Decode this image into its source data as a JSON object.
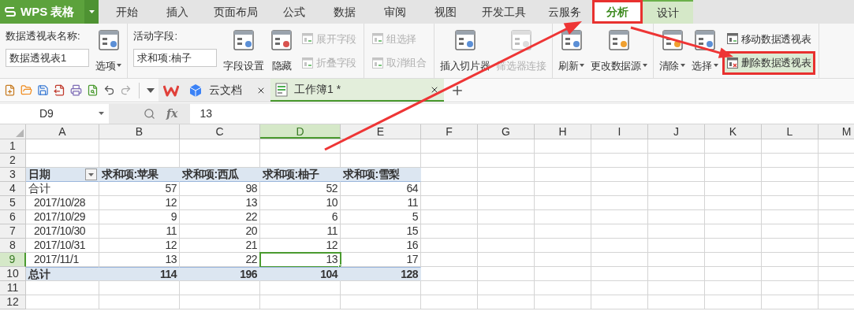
{
  "app": {
    "logo": "WPS 表格"
  },
  "menu_tabs": [
    {
      "label": "开始",
      "selected": false,
      "contextual": false,
      "highlighted": false
    },
    {
      "label": "插入",
      "selected": false,
      "contextual": false,
      "highlighted": false
    },
    {
      "label": "页面布局",
      "selected": false,
      "contextual": false,
      "highlighted": false
    },
    {
      "label": "公式",
      "selected": false,
      "contextual": false,
      "highlighted": false
    },
    {
      "label": "数据",
      "selected": false,
      "contextual": false,
      "highlighted": false
    },
    {
      "label": "审阅",
      "selected": false,
      "contextual": false,
      "highlighted": false
    },
    {
      "label": "视图",
      "selected": false,
      "contextual": false,
      "highlighted": false
    },
    {
      "label": "开发工具",
      "selected": false,
      "contextual": false,
      "highlighted": false
    },
    {
      "label": "云服务",
      "selected": false,
      "contextual": false,
      "highlighted": false
    },
    {
      "label": "分析",
      "selected": true,
      "contextual": true,
      "highlighted": true
    },
    {
      "label": "设计",
      "selected": false,
      "contextual": true,
      "highlighted": false
    }
  ],
  "ribbon": {
    "groups": [
      {
        "items": [
          {
            "kind": "field",
            "label": "数据透视表名称:",
            "value": "数据透视表1"
          },
          {
            "kind": "big",
            "label": "选项",
            "dropdown": true,
            "disabled": false
          }
        ]
      },
      {
        "items": [
          {
            "kind": "field",
            "label": "活动字段:",
            "value": "求和项:柚子"
          },
          {
            "kind": "big",
            "label": "字段设置",
            "dropdown": false,
            "disabled": false
          },
          {
            "kind": "big",
            "label": "隐藏",
            "dropdown": false,
            "disabled": false
          },
          {
            "kind": "small",
            "label": "展开字段",
            "disabled": true,
            "highlighted": false
          },
          {
            "kind": "small",
            "label": "折叠字段",
            "disabled": true,
            "highlighted": false
          }
        ]
      },
      {
        "items": [
          {
            "kind": "small",
            "label": "组选择",
            "disabled": true,
            "highlighted": false
          },
          {
            "kind": "small",
            "label": "取消组合",
            "disabled": true,
            "highlighted": false
          }
        ]
      },
      {
        "items": [
          {
            "kind": "big",
            "label": "插入切片器",
            "dropdown": false,
            "disabled": false
          },
          {
            "kind": "big",
            "label": "筛选器连接",
            "dropdown": false,
            "disabled": true
          }
        ]
      },
      {
        "items": [
          {
            "kind": "big",
            "label": "刷新",
            "dropdown": true,
            "disabled": false
          },
          {
            "kind": "big",
            "label": "更改数据源",
            "dropdown": true,
            "disabled": false
          }
        ]
      },
      {
        "items": [
          {
            "kind": "big",
            "label": "清除",
            "dropdown": true,
            "disabled": false
          },
          {
            "kind": "big",
            "label": "选择",
            "dropdown": true,
            "disabled": false
          },
          {
            "kind": "small",
            "label": "移动数据透视表",
            "disabled": false,
            "highlighted": false
          },
          {
            "kind": "small",
            "label": "删除数据透视表",
            "disabled": false,
            "highlighted": true
          }
        ]
      }
    ]
  },
  "doc_tabs": [
    {
      "kind": "home",
      "selected": false
    },
    {
      "kind": "cloud",
      "label": "云文档",
      "selected": false
    },
    {
      "kind": "sheet",
      "label": "工作簿1 *",
      "selected": true
    }
  ],
  "formula_bar": {
    "cell": "D9",
    "fx": "fx",
    "value": "13"
  },
  "sheet": {
    "columns": [
      {
        "label": "A",
        "selected": false
      },
      {
        "label": "B",
        "selected": false
      },
      {
        "label": "C",
        "selected": false
      },
      {
        "label": "D",
        "selected": true
      },
      {
        "label": "E",
        "selected": false
      },
      {
        "label": "F",
        "selected": false
      },
      {
        "label": "G",
        "selected": false
      },
      {
        "label": "H",
        "selected": false
      },
      {
        "label": "I",
        "selected": false
      },
      {
        "label": "J",
        "selected": false
      },
      {
        "label": "K",
        "selected": false
      },
      {
        "label": "L",
        "selected": false
      },
      {
        "label": "M",
        "selected": false
      }
    ],
    "rows": [
      {
        "number": "1",
        "selected": false,
        "kind": "empty"
      },
      {
        "number": "2",
        "selected": false,
        "kind": "empty"
      },
      {
        "number": "3",
        "selected": false,
        "kind": "header",
        "filter_button": true,
        "cells": [
          "日期",
          "求和项:苹果",
          "求和项:西瓜",
          "求和项:柚子",
          "求和项:雪梨"
        ]
      },
      {
        "number": "4",
        "selected": false,
        "kind": "subtotal",
        "cells": [
          "合计",
          "57",
          "98",
          "52",
          "64"
        ]
      },
      {
        "number": "5",
        "selected": false,
        "kind": "item",
        "cells": [
          "2017/10/28",
          "12",
          "13",
          "10",
          "11"
        ]
      },
      {
        "number": "6",
        "selected": false,
        "kind": "item",
        "cells": [
          "2017/10/29",
          "9",
          "22",
          "6",
          "5"
        ]
      },
      {
        "number": "7",
        "selected": false,
        "kind": "item",
        "cells": [
          "2017/10/30",
          "11",
          "20",
          "11",
          "15"
        ]
      },
      {
        "number": "8",
        "selected": false,
        "kind": "item",
        "cells": [
          "2017/10/31",
          "12",
          "21",
          "12",
          "16"
        ]
      },
      {
        "number": "9",
        "selected": true,
        "kind": "item",
        "cells": [
          "2017/11/1",
          "13",
          "22",
          "13",
          "17"
        ]
      },
      {
        "number": "10",
        "selected": false,
        "kind": "total",
        "cells": [
          "总计",
          "114",
          "196",
          "104",
          "128"
        ]
      },
      {
        "number": "11",
        "selected": false,
        "kind": "empty"
      },
      {
        "number": "12",
        "selected": false,
        "kind": "empty"
      }
    ]
  }
}
